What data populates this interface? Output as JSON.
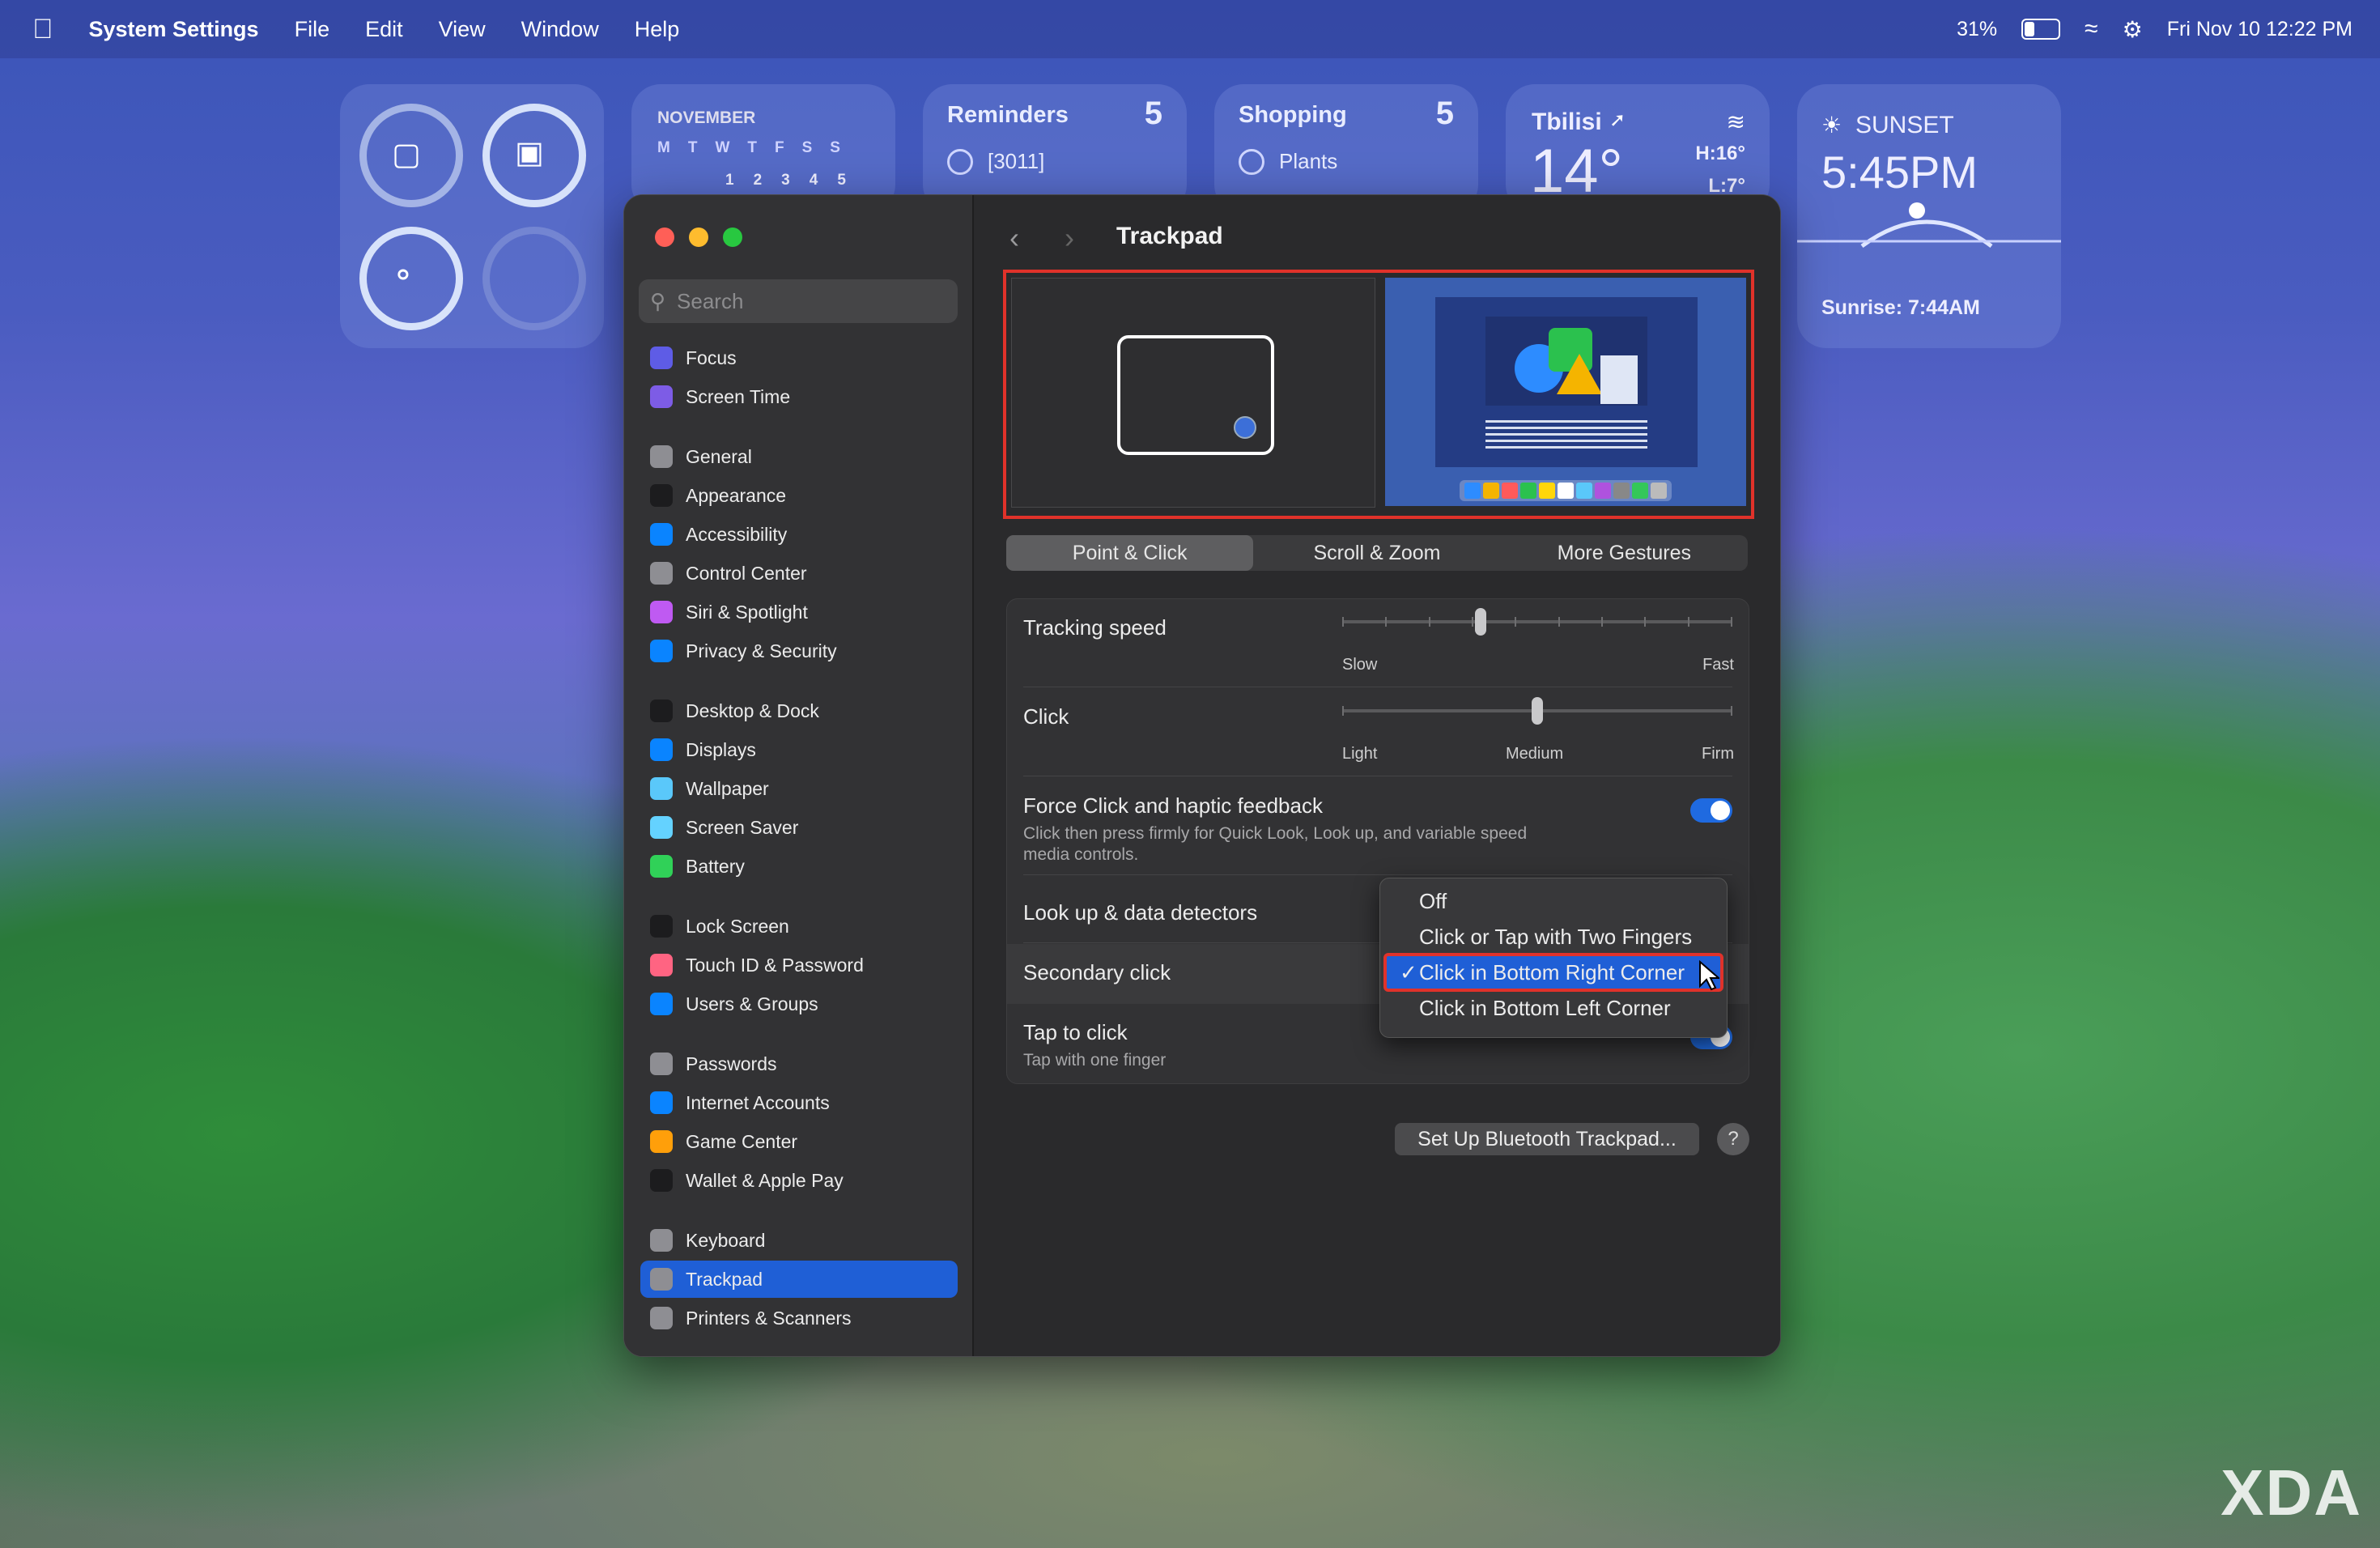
{
  "menubar": {
    "app": "System Settings",
    "items": [
      "File",
      "Edit",
      "View",
      "Window",
      "Help"
    ],
    "battery": "31%",
    "datetime": "Fri Nov 10  12:22 PM"
  },
  "widgets": {
    "calendar": {
      "month": "NOVEMBER",
      "days": [
        "M",
        "T",
        "W",
        "T",
        "F",
        "S",
        "S"
      ],
      "dates": [
        "1",
        "2",
        "3",
        "4",
        "5"
      ]
    },
    "reminders": {
      "title": "Reminders",
      "count": "5",
      "item": "[3011]"
    },
    "shopping": {
      "title": "Shopping",
      "count": "5",
      "item": "Plants"
    },
    "weather": {
      "city": "Tbilisi",
      "temp": "14°",
      "high": "H:16°",
      "low": "L:7°"
    },
    "sunset": {
      "label": "SUNSET",
      "time": "5:45PM",
      "sunrise": "Sunrise: 7:44AM"
    }
  },
  "sidebar": {
    "search_placeholder": "Search",
    "items": [
      {
        "label": "Focus",
        "color": "#5e5ce6"
      },
      {
        "label": "Screen Time",
        "color": "#7d5ce6"
      },
      {
        "label": "General",
        "color": "#8e8e93"
      },
      {
        "label": "Appearance",
        "color": "#1c1c1e"
      },
      {
        "label": "Accessibility",
        "color": "#0a84ff"
      },
      {
        "label": "Control Center",
        "color": "#8e8e93"
      },
      {
        "label": "Siri & Spotlight",
        "color": "#bf5af2"
      },
      {
        "label": "Privacy & Security",
        "color": "#0a84ff"
      },
      {
        "label": "Desktop & Dock",
        "color": "#1c1c1e"
      },
      {
        "label": "Displays",
        "color": "#0a84ff"
      },
      {
        "label": "Wallpaper",
        "color": "#5ac8fa"
      },
      {
        "label": "Screen Saver",
        "color": "#64d2ff"
      },
      {
        "label": "Battery",
        "color": "#30d158"
      },
      {
        "label": "Lock Screen",
        "color": "#1c1c1e"
      },
      {
        "label": "Touch ID & Password",
        "color": "#ff6482"
      },
      {
        "label": "Users & Groups",
        "color": "#0a84ff"
      },
      {
        "label": "Passwords",
        "color": "#8e8e93"
      },
      {
        "label": "Internet Accounts",
        "color": "#0a84ff"
      },
      {
        "label": "Game Center",
        "color": "#ff9f0a"
      },
      {
        "label": "Wallet & Apple Pay",
        "color": "#1c1c1e"
      },
      {
        "label": "Keyboard",
        "color": "#8e8e93"
      },
      {
        "label": "Trackpad",
        "color": "#8e8e93"
      },
      {
        "label": "Printers & Scanners",
        "color": "#8e8e93"
      }
    ],
    "selected": "Trackpad"
  },
  "content": {
    "title": "Trackpad",
    "tabs": [
      "Point & Click",
      "Scroll & Zoom",
      "More Gestures"
    ],
    "tracking_speed": {
      "label": "Tracking speed",
      "min": "Slow",
      "max": "Fast",
      "level": 0.35
    },
    "click": {
      "label": "Click",
      "min": "Light",
      "mid": "Medium",
      "max": "Firm",
      "level": 0.5
    },
    "force_click": {
      "label": "Force Click and haptic feedback",
      "desc1": "Click then press firmly for Quick Look, Look up, and variable speed",
      "desc2": "media controls.",
      "on": true
    },
    "lookup": {
      "label": "Look up & data detectors"
    },
    "secondary": {
      "label": "Secondary click"
    },
    "tap": {
      "label": "Tap to click",
      "desc": "Tap with one finger"
    },
    "setup_button": "Set Up Bluetooth Trackpad...",
    "help": "?"
  },
  "dropdown": {
    "options": [
      "Off",
      "Click or Tap with Two Fingers",
      "Click in Bottom Right Corner",
      "Click in Bottom Left Corner"
    ],
    "selected": "Click in Bottom Right Corner",
    "check": "✓"
  },
  "watermark": "XDA"
}
